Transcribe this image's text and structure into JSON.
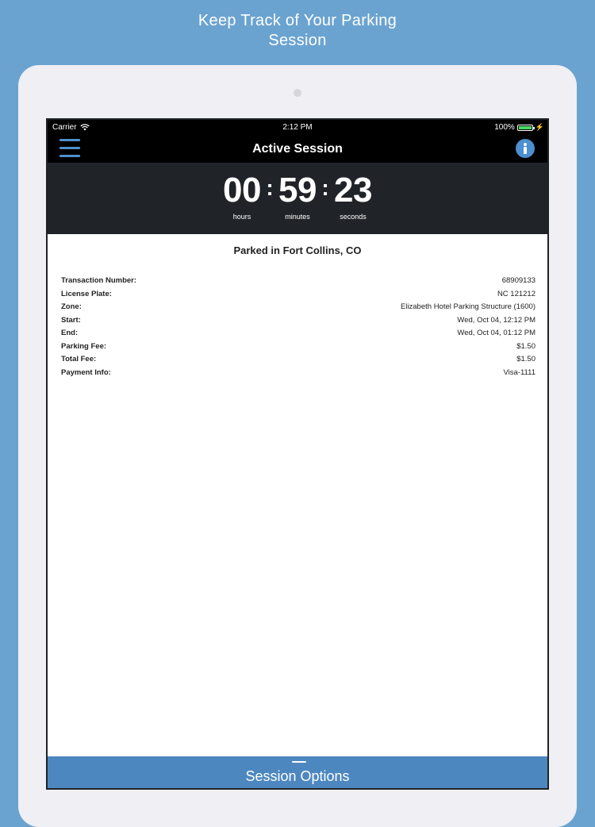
{
  "headline": {
    "line1": "Keep Track of Your Parking",
    "line2": "Session"
  },
  "status_bar": {
    "carrier": "Carrier",
    "time": "2:12 PM",
    "battery": "100%"
  },
  "nav": {
    "title": "Active Session",
    "menu_icon": "hamburger-menu-icon",
    "info_icon": "info-icon"
  },
  "timer": {
    "hours": "00",
    "minutes": "59",
    "seconds": "23",
    "hours_label": "hours",
    "minutes_label": "minutes",
    "seconds_label": "seconds",
    "separator": ":"
  },
  "details": {
    "title": "Parked in Fort Collins, CO",
    "rows": [
      {
        "label": "Transaction Number:",
        "value": "68909133"
      },
      {
        "label": "License Plate:",
        "value": "NC 121212"
      },
      {
        "label": "Zone:",
        "value": "Elizabeth Hotel Parking Structure (1600)"
      },
      {
        "label": "Start:",
        "value": "Wed, Oct 04, 12:12 PM"
      },
      {
        "label": "End:",
        "value": "Wed, Oct 04, 01:12 PM"
      },
      {
        "label": "Parking Fee:",
        "value": "$1.50"
      },
      {
        "label": "Total Fee:",
        "value": "$1.50"
      },
      {
        "label": "Payment Info:",
        "value": "Visa-1111"
      }
    ]
  },
  "footer": {
    "session_options_label": "Session Options"
  },
  "colors": {
    "background": "#6aa3d0",
    "accent": "#4d8fcf",
    "timer_panel": "#202428",
    "bottom_bar": "#4d87c0",
    "battery": "#4cd964"
  },
  "battery_level": 1.0
}
